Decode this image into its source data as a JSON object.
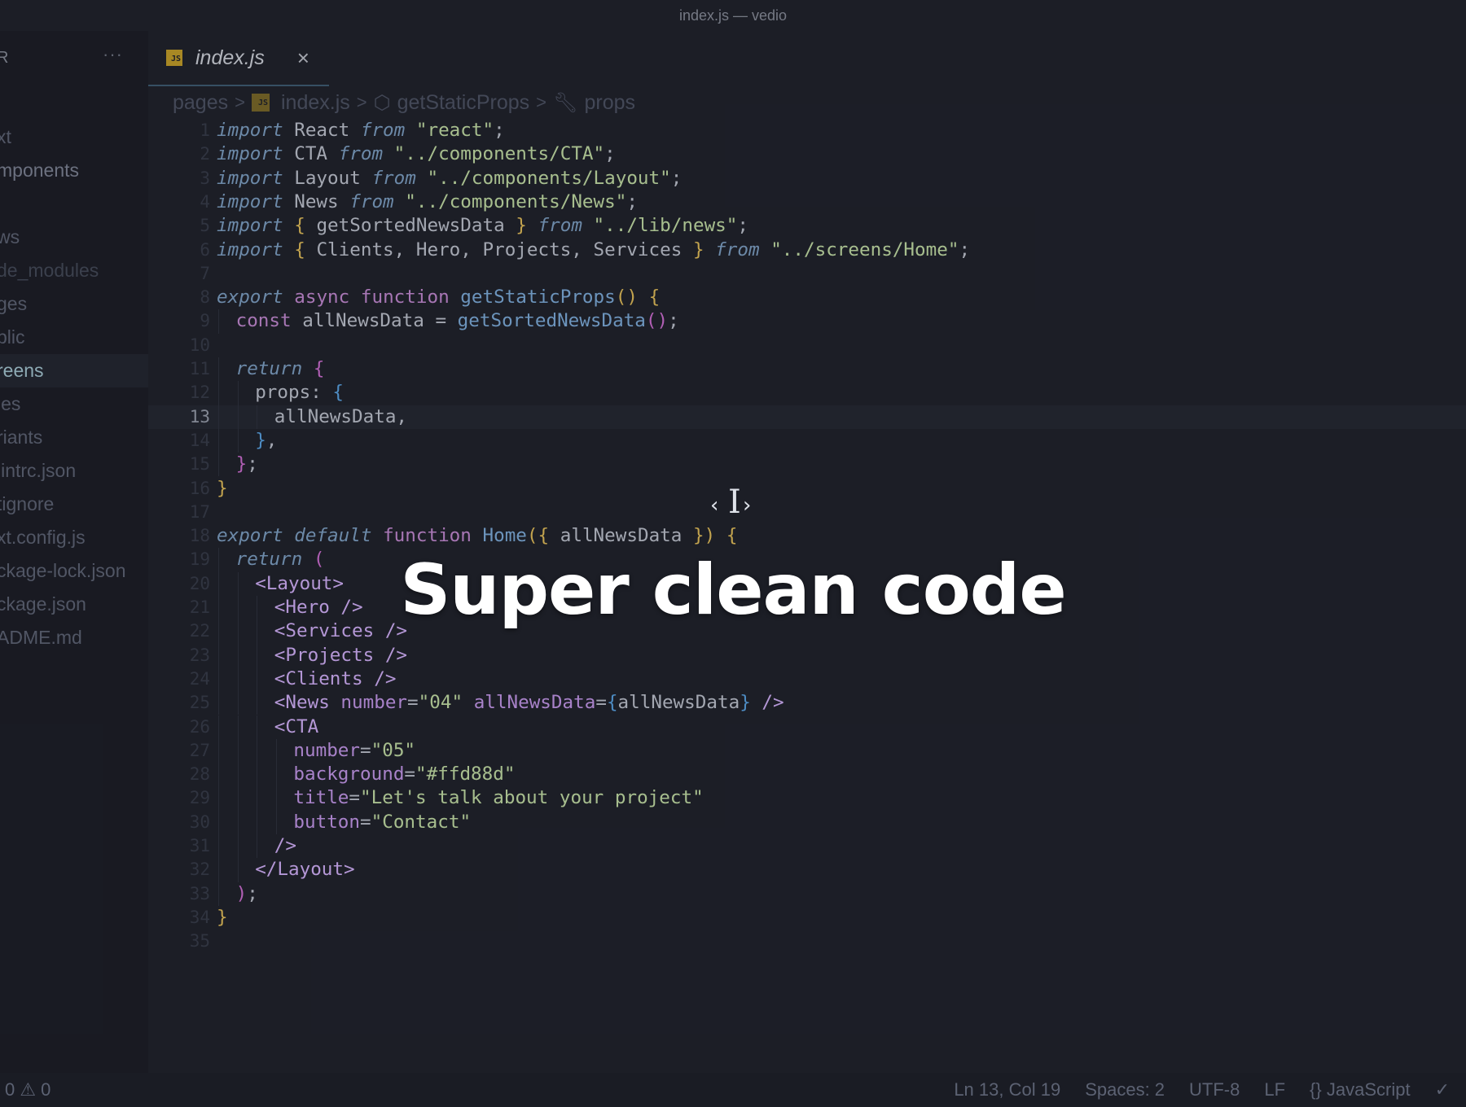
{
  "window": {
    "title": "index.js — vedio"
  },
  "sidebar": {
    "header": "R",
    "more": "···",
    "items": [
      {
        "label": "xt",
        "style": "normal"
      },
      {
        "label": "mponents",
        "style": "hi"
      },
      {
        "label": "",
        "style": "normal"
      },
      {
        "label": "ws",
        "style": "normal"
      },
      {
        "label": "de_modules",
        "style": "dim"
      },
      {
        "label": "ges",
        "style": "normal"
      },
      {
        "label": "blic",
        "style": "normal"
      },
      {
        "label": "reens",
        "style": "active"
      },
      {
        "label": "les",
        "style": "normal"
      },
      {
        "label": "riants",
        "style": "normal"
      },
      {
        "label": "lintrc.json",
        "style": "normal"
      },
      {
        "label": "tignore",
        "style": "normal"
      },
      {
        "label": "xt.config.js",
        "style": "normal"
      },
      {
        "label": "ckage-lock.json",
        "style": "normal"
      },
      {
        "label": "ckage.json",
        "style": "normal"
      },
      {
        "label": "ADME.md",
        "style": "normal"
      }
    ]
  },
  "tab": {
    "badge": "JS",
    "label": "index.js",
    "close": "×"
  },
  "breadcrumb": {
    "folder": "pages",
    "badge": "JS",
    "file": "index.js",
    "symbol": "getStaticProps",
    "prop": "props",
    "sep": ">"
  },
  "editor": {
    "current_line": 13,
    "lines": [
      {
        "n": "1",
        "indent": 0,
        "tokens": [
          [
            "kw",
            "import"
          ],
          [
            "plain",
            " React "
          ],
          [
            "kw",
            "from"
          ],
          [
            "plain",
            " "
          ],
          [
            "str",
            "\"react\""
          ],
          [
            "plain",
            ";"
          ]
        ]
      },
      {
        "n": "2",
        "indent": 0,
        "tokens": [
          [
            "kw",
            "import"
          ],
          [
            "plain",
            " CTA "
          ],
          [
            "kw",
            "from"
          ],
          [
            "plain",
            " "
          ],
          [
            "str",
            "\"../components/CTA\""
          ],
          [
            "plain",
            ";"
          ]
        ]
      },
      {
        "n": "3",
        "indent": 0,
        "tokens": [
          [
            "kw",
            "import"
          ],
          [
            "plain",
            " Layout "
          ],
          [
            "kw",
            "from"
          ],
          [
            "plain",
            " "
          ],
          [
            "str",
            "\"../components/Layout\""
          ],
          [
            "plain",
            ";"
          ]
        ]
      },
      {
        "n": "4",
        "indent": 0,
        "tokens": [
          [
            "kw",
            "import"
          ],
          [
            "plain",
            " News "
          ],
          [
            "kw",
            "from"
          ],
          [
            "plain",
            " "
          ],
          [
            "str",
            "\"../components/News\""
          ],
          [
            "plain",
            ";"
          ]
        ]
      },
      {
        "n": "5",
        "indent": 0,
        "tokens": [
          [
            "kw",
            "import"
          ],
          [
            "plain",
            " "
          ],
          [
            "br1",
            "{"
          ],
          [
            "plain",
            " getSortedNewsData "
          ],
          [
            "br1",
            "}"
          ],
          [
            "plain",
            " "
          ],
          [
            "kw",
            "from"
          ],
          [
            "plain",
            " "
          ],
          [
            "str",
            "\"../lib/news\""
          ],
          [
            "plain",
            ";"
          ]
        ]
      },
      {
        "n": "6",
        "indent": 0,
        "tokens": [
          [
            "kw",
            "import"
          ],
          [
            "plain",
            " "
          ],
          [
            "br1",
            "{"
          ],
          [
            "plain",
            " Clients, Hero, Projects, Services "
          ],
          [
            "br1",
            "}"
          ],
          [
            "plain",
            " "
          ],
          [
            "kw",
            "from"
          ],
          [
            "plain",
            " "
          ],
          [
            "str",
            "\"../screens/Home\""
          ],
          [
            "plain",
            ";"
          ]
        ]
      },
      {
        "n": "7",
        "indent": 0,
        "tokens": []
      },
      {
        "n": "8",
        "indent": 0,
        "tokens": [
          [
            "kw",
            "export"
          ],
          [
            "plain",
            " "
          ],
          [
            "kw2",
            "async"
          ],
          [
            "plain",
            " "
          ],
          [
            "kw2",
            "function"
          ],
          [
            "plain",
            " "
          ],
          [
            "fn",
            "getStaticProps"
          ],
          [
            "br1",
            "()"
          ],
          [
            "plain",
            " "
          ],
          [
            "br1",
            "{"
          ]
        ]
      },
      {
        "n": "9",
        "indent": 1,
        "tokens": [
          [
            "kw2",
            "const"
          ],
          [
            "plain",
            " allNewsData = "
          ],
          [
            "fn",
            "getSortedNewsData"
          ],
          [
            "br2",
            "()"
          ],
          [
            "plain",
            ";"
          ]
        ]
      },
      {
        "n": "10",
        "indent": 0,
        "tokens": []
      },
      {
        "n": "11",
        "indent": 1,
        "tokens": [
          [
            "kw",
            "return"
          ],
          [
            "plain",
            " "
          ],
          [
            "br2",
            "{"
          ]
        ]
      },
      {
        "n": "12",
        "indent": 2,
        "tokens": [
          [
            "plain",
            "props: "
          ],
          [
            "br3",
            "{"
          ]
        ]
      },
      {
        "n": "13",
        "indent": 3,
        "tokens": [
          [
            "plain",
            "allNewsData,"
          ]
        ]
      },
      {
        "n": "14",
        "indent": 2,
        "tokens": [
          [
            "br3",
            "}"
          ],
          [
            "plain",
            ","
          ]
        ]
      },
      {
        "n": "15",
        "indent": 1,
        "tokens": [
          [
            "br2",
            "}"
          ],
          [
            "plain",
            ";"
          ]
        ]
      },
      {
        "n": "16",
        "indent": 0,
        "tokens": [
          [
            "br1",
            "}"
          ]
        ]
      },
      {
        "n": "17",
        "indent": 0,
        "tokens": []
      },
      {
        "n": "18",
        "indent": 0,
        "tokens": [
          [
            "kw",
            "export"
          ],
          [
            "plain",
            " "
          ],
          [
            "kw",
            "default"
          ],
          [
            "plain",
            " "
          ],
          [
            "kw2",
            "function"
          ],
          [
            "plain",
            " "
          ],
          [
            "fn",
            "Home"
          ],
          [
            "br1",
            "({"
          ],
          [
            "plain",
            " allNewsData "
          ],
          [
            "br1",
            "})"
          ],
          [
            "plain",
            " "
          ],
          [
            "br1",
            "{"
          ]
        ]
      },
      {
        "n": "19",
        "indent": 1,
        "tokens": [
          [
            "kw",
            "return"
          ],
          [
            "plain",
            " "
          ],
          [
            "br2",
            "("
          ]
        ]
      },
      {
        "n": "20",
        "indent": 2,
        "tokens": [
          [
            "tag",
            "<Layout>"
          ]
        ]
      },
      {
        "n": "21",
        "indent": 3,
        "tokens": [
          [
            "tag",
            "<Hero />"
          ]
        ]
      },
      {
        "n": "22",
        "indent": 3,
        "tokens": [
          [
            "tag",
            "<Services />"
          ]
        ]
      },
      {
        "n": "23",
        "indent": 3,
        "tokens": [
          [
            "tag",
            "<Projects />"
          ]
        ]
      },
      {
        "n": "24",
        "indent": 3,
        "tokens": [
          [
            "tag",
            "<Clients />"
          ]
        ]
      },
      {
        "n": "25",
        "indent": 3,
        "tokens": [
          [
            "tag",
            "<News"
          ],
          [
            "plain",
            " "
          ],
          [
            "attr",
            "number"
          ],
          [
            "plain",
            "="
          ],
          [
            "str",
            "\"04\""
          ],
          [
            "plain",
            " "
          ],
          [
            "attr",
            "allNewsData"
          ],
          [
            "plain",
            "="
          ],
          [
            "br3",
            "{"
          ],
          [
            "plain",
            "allNewsData"
          ],
          [
            "br3",
            "}"
          ],
          [
            "plain",
            " "
          ],
          [
            "tag",
            "/>"
          ]
        ]
      },
      {
        "n": "26",
        "indent": 3,
        "tokens": [
          [
            "tag",
            "<CTA"
          ]
        ]
      },
      {
        "n": "27",
        "indent": 4,
        "tokens": [
          [
            "attr",
            "number"
          ],
          [
            "plain",
            "="
          ],
          [
            "str",
            "\"05\""
          ]
        ]
      },
      {
        "n": "28",
        "indent": 4,
        "tokens": [
          [
            "attr",
            "background"
          ],
          [
            "plain",
            "="
          ],
          [
            "str",
            "\"#ffd88d\""
          ]
        ]
      },
      {
        "n": "29",
        "indent": 4,
        "tokens": [
          [
            "attr",
            "title"
          ],
          [
            "plain",
            "="
          ],
          [
            "str",
            "\"Let's talk about your project\""
          ]
        ]
      },
      {
        "n": "30",
        "indent": 4,
        "tokens": [
          [
            "attr",
            "button"
          ],
          [
            "plain",
            "="
          ],
          [
            "str",
            "\"Contact\""
          ]
        ]
      },
      {
        "n": "31",
        "indent": 3,
        "tokens": [
          [
            "tag",
            "/>"
          ]
        ]
      },
      {
        "n": "32",
        "indent": 2,
        "tokens": [
          [
            "tag",
            "</Layout>"
          ]
        ]
      },
      {
        "n": "33",
        "indent": 1,
        "tokens": [
          [
            "br2",
            ")"
          ],
          [
            "plain",
            ";"
          ]
        ]
      },
      {
        "n": "34",
        "indent": 0,
        "tokens": [
          [
            "br1",
            "}"
          ]
        ]
      },
      {
        "n": "35",
        "indent": 0,
        "tokens": []
      }
    ]
  },
  "overlay": {
    "caption": "Super clean code"
  },
  "cursor": {
    "left": "‹",
    "beam": "I",
    "right": "›"
  },
  "status": {
    "errors_warnings": "0 ⚠ 0",
    "position": "Ln 13, Col 19",
    "spaces": "Spaces: 2",
    "encoding": "UTF-8",
    "eol": "LF",
    "language": "{} JavaScript",
    "check": "✓"
  }
}
